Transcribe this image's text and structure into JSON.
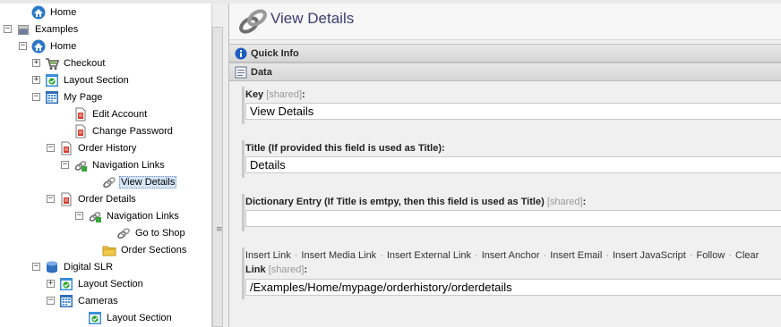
{
  "tree": {
    "nodes": [
      {
        "label": "Home",
        "icon": "home-icon",
        "toggle": ""
      },
      {
        "label": "Examples",
        "icon": "package-icon",
        "toggle": "−"
      },
      {
        "label": "Home",
        "icon": "home-icon",
        "toggle": "−"
      },
      {
        "label": "Checkout",
        "icon": "cart-icon",
        "toggle": "+"
      },
      {
        "label": "Layout Section",
        "icon": "check-window-icon",
        "toggle": "+"
      },
      {
        "label": "My Page",
        "icon": "grid-icon",
        "toggle": "−"
      },
      {
        "label": "Edit Account",
        "icon": "page-icon",
        "toggle": ""
      },
      {
        "label": "Change Password",
        "icon": "page-icon",
        "toggle": ""
      },
      {
        "label": "Order History",
        "icon": "page-icon",
        "toggle": "−"
      },
      {
        "label": "Navigation Links",
        "icon": "links-icon",
        "toggle": "−"
      },
      {
        "label": "View Details",
        "icon": "link-icon",
        "toggle": ""
      },
      {
        "label": "Order Details",
        "icon": "page-icon",
        "toggle": "−"
      },
      {
        "label": "Navigation Links",
        "icon": "links-icon",
        "toggle": "−"
      },
      {
        "label": "Go to Shop",
        "icon": "link-icon",
        "toggle": ""
      },
      {
        "label": "Order Sections",
        "icon": "folder-icon",
        "toggle": ""
      },
      {
        "label": "Digital SLR",
        "icon": "database-icon",
        "toggle": "−"
      },
      {
        "label": "Layout Section",
        "icon": "check-window-icon",
        "toggle": "+"
      },
      {
        "label": "Cameras",
        "icon": "grid-icon",
        "toggle": "−"
      },
      {
        "label": "Layout Section",
        "icon": "check-window-icon",
        "toggle": ""
      }
    ]
  },
  "editor": {
    "title": "View Details",
    "sections": {
      "quick_info": "Quick Info",
      "data": "Data"
    },
    "fields": {
      "key_label": "Key",
      "shared": "[shared]",
      "colon": ":",
      "key_value": "View Details",
      "title_label": "Title (If provided this field is used as Title):",
      "title_value": "Details",
      "dict_label": "Dictionary Entry (If Title is emtpy, then this field is used as Title)",
      "dict_value": "",
      "link_label": "Link",
      "link_value": "/Examples/Home/mypage/orderhistory/orderdetails"
    },
    "link_actions": [
      "Insert Link",
      "Insert Media Link",
      "Insert External Link",
      "Insert Anchor",
      "Insert Email",
      "Insert JavaScript",
      "Follow",
      "Clear"
    ]
  },
  "colors": {
    "title": "#3c3c72",
    "selection": "#d6e6f7"
  }
}
